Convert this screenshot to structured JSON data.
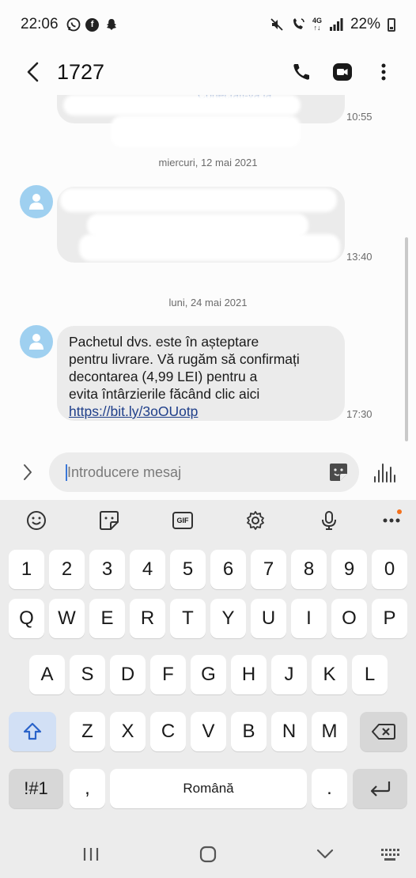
{
  "status_bar": {
    "time": "22:06",
    "network": "4G",
    "battery": "22%"
  },
  "header": {
    "contact": "1727"
  },
  "conversation": {
    "dates": [
      "miercuri, 12 mai 2021",
      "luni, 24 mai 2021"
    ],
    "messages": [
      {
        "time": "10:55"
      },
      {
        "time": "13:40"
      },
      {
        "lines": [
          "Pachetul dvs. este în așteptare",
          "pentru livrare. Vă rugăm să confirmați",
          "decontarea (4,99 LEI) pentru a",
          "evita întârzierile făcând clic aici"
        ],
        "link": "https://bit.ly/3oOUotp",
        "time": "17:30"
      }
    ]
  },
  "composer": {
    "placeholder": "Introducere mesaj"
  },
  "keyboard": {
    "toolbar": [
      "emoji-icon",
      "sticker-icon",
      "gif-icon",
      "settings-icon",
      "mic-icon",
      "more-icon"
    ],
    "gif_label": "GIF",
    "number_row": [
      "1",
      "2",
      "3",
      "4",
      "5",
      "6",
      "7",
      "8",
      "9",
      "0"
    ],
    "row1": [
      "Q",
      "W",
      "E",
      "R",
      "T",
      "Y",
      "U",
      "I",
      "O",
      "P"
    ],
    "row2": [
      "A",
      "S",
      "D",
      "F",
      "G",
      "H",
      "J",
      "K",
      "L"
    ],
    "row3": [
      "Z",
      "X",
      "C",
      "V",
      "B",
      "N",
      "M"
    ],
    "symbols": "!#1",
    "comma": ",",
    "space": "Română",
    "period": ".",
    "accent": "#f4711c"
  }
}
